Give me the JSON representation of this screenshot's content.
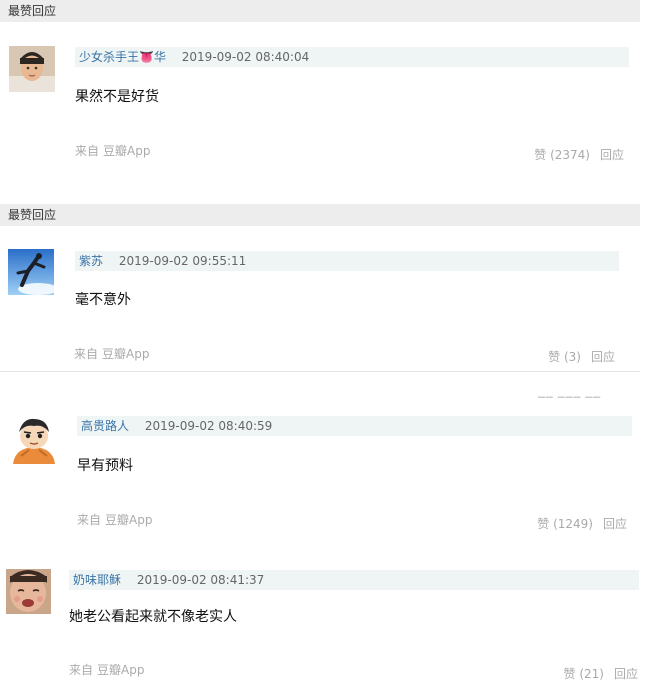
{
  "sections": [
    {
      "header": "最赞回应"
    },
    {
      "header": "最赞回应"
    }
  ],
  "comments": [
    {
      "user": "少女杀手王👅华",
      "time": "2019-09-02 08:40:04",
      "text": "果然不是好货",
      "from": "来自",
      "app": "豆瓣App",
      "likes": "赞 (2374)",
      "reply": "回应"
    },
    {
      "user": "紫苏",
      "time": "2019-09-02 09:55:11",
      "text": "毫不意外",
      "from": "来自",
      "app": "豆瓣App",
      "likes": "赞 (3)",
      "reply": "回应"
    },
    {
      "user": "高贵路人",
      "time": "2019-09-02 08:40:59",
      "text": "早有预料",
      "from": "来自",
      "app": "豆瓣App",
      "likes": "赞 (1249)",
      "reply": "回应"
    },
    {
      "user": "奶味耶稣",
      "time": "2019-09-02 08:41:37",
      "text": "她老公看起来就不像老实人",
      "from": "来自",
      "app": "豆瓣App",
      "likes": "赞 (21)",
      "reply": "回应"
    }
  ]
}
